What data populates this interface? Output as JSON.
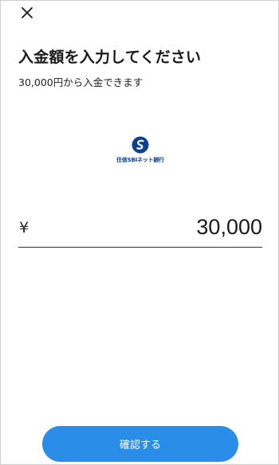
{
  "header": {
    "close_icon": "close-icon",
    "title": "入金額を入力してください",
    "subtitle": "30,000円から入金できます"
  },
  "bank": {
    "name": "住信SBIネット銀行",
    "logo_icon": "bank-logo-icon",
    "brand_color": "#0b3f8f"
  },
  "amount": {
    "currency_symbol": "¥",
    "value": "30,000"
  },
  "footer": {
    "confirm_label": "確認する",
    "accent_color": "#2a8de8"
  }
}
